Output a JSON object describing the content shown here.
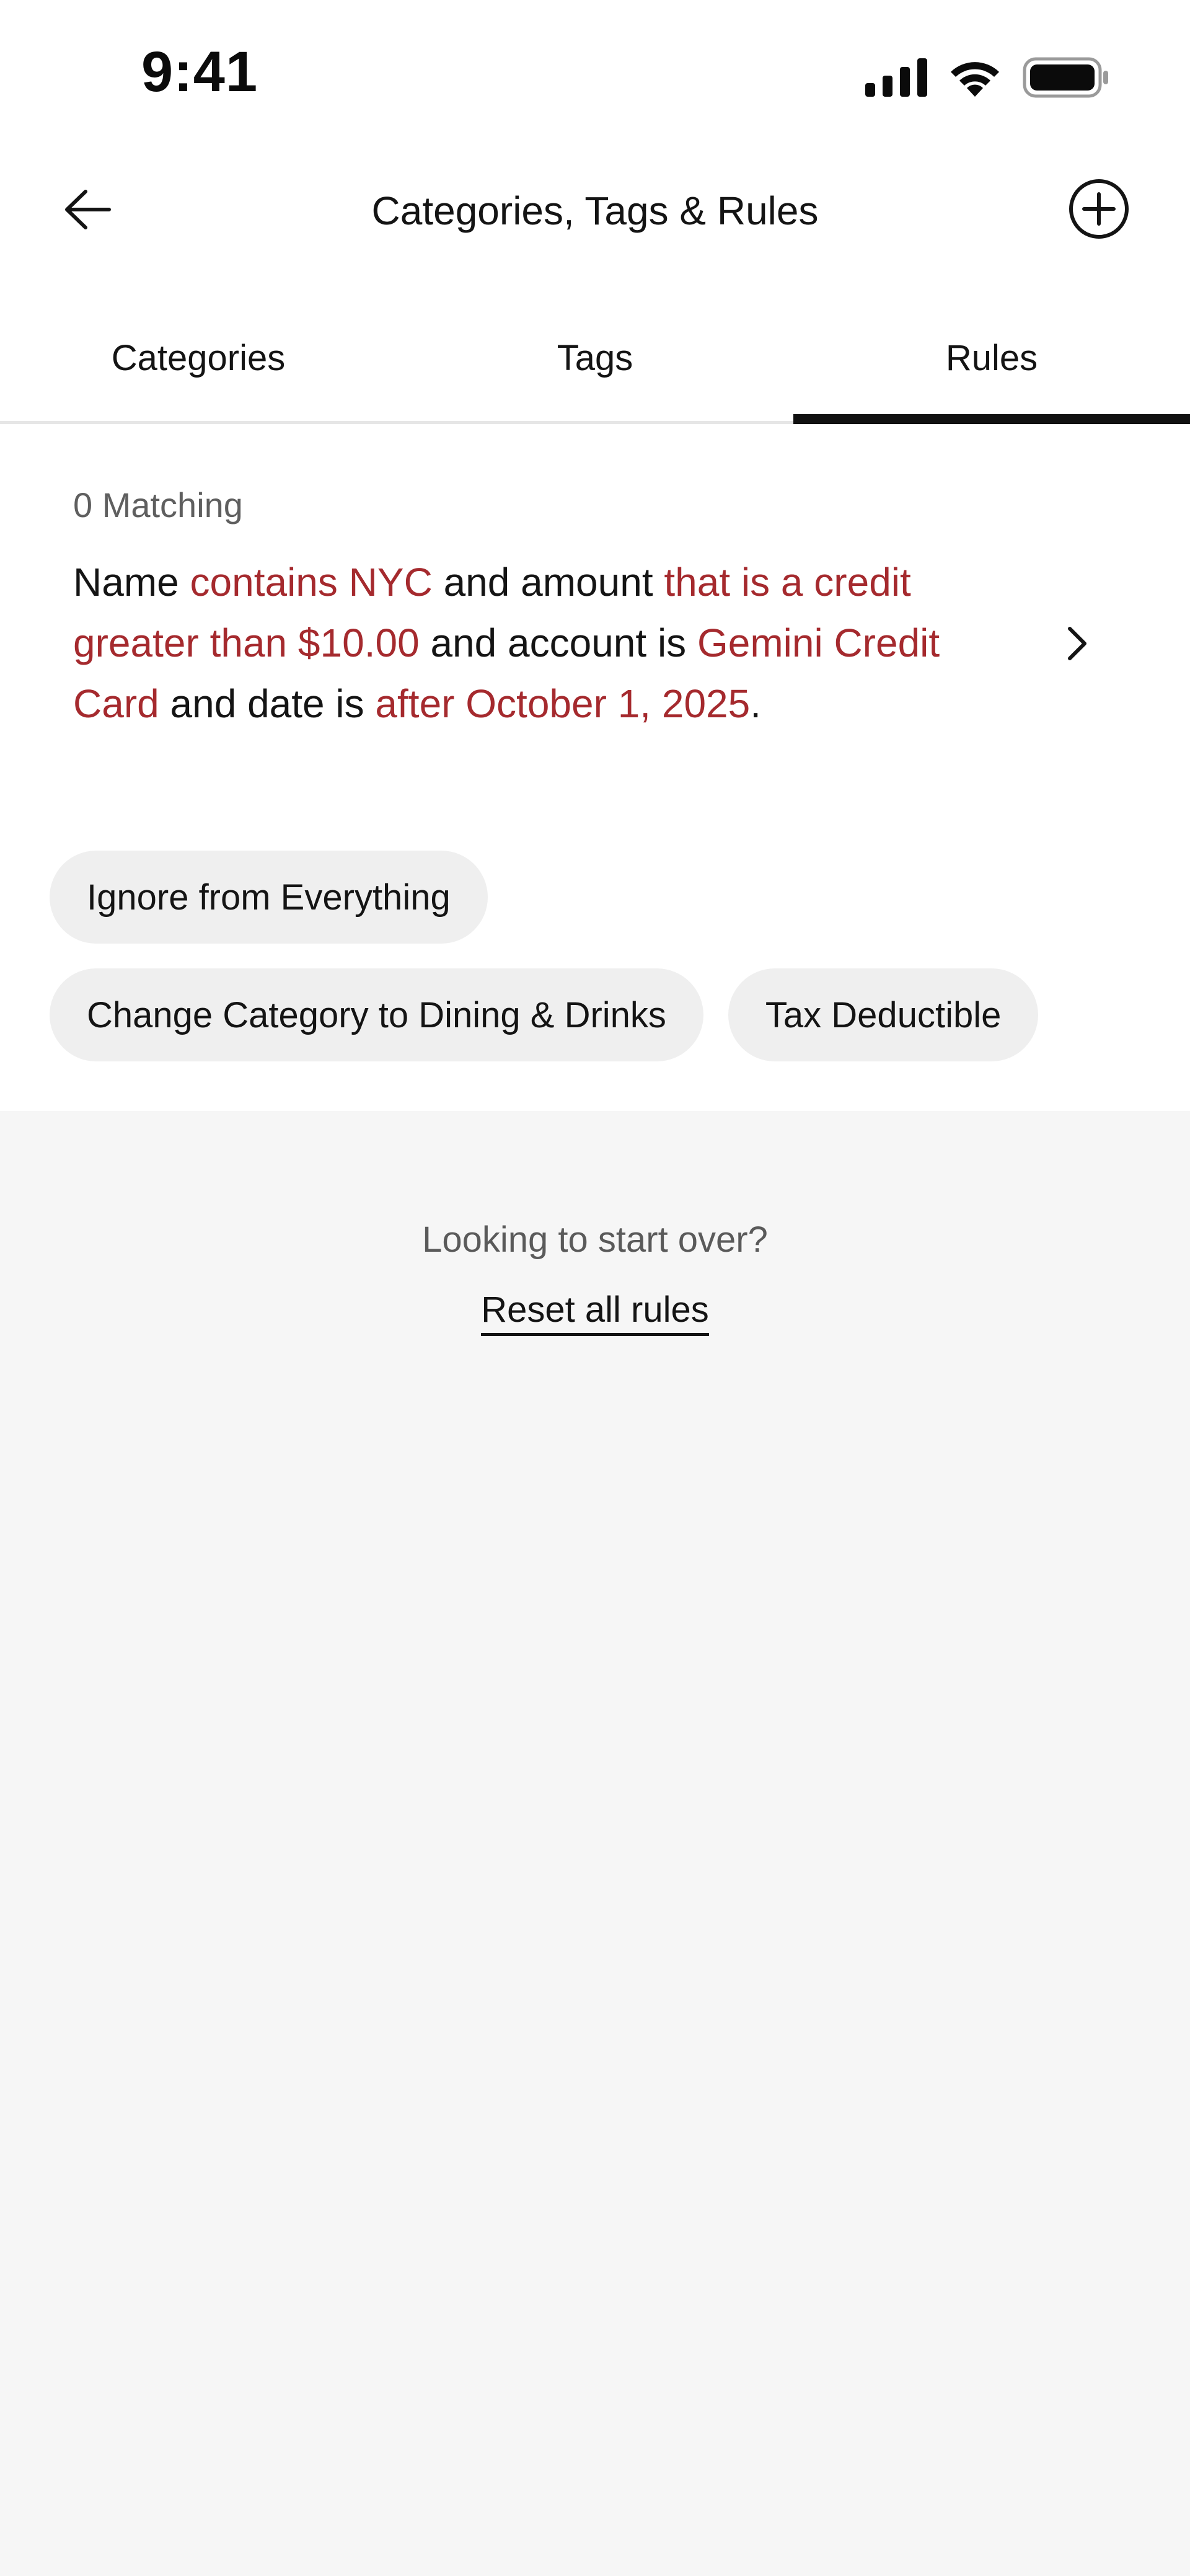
{
  "status_bar": {
    "time": "9:41",
    "icons": [
      "signal-icon",
      "wifi-icon",
      "battery-icon"
    ]
  },
  "header": {
    "title": "Categories, Tags & Rules",
    "back_icon": "arrow-left-icon",
    "add_icon": "plus-circle-icon"
  },
  "tabs": [
    {
      "label": "Categories",
      "active": false
    },
    {
      "label": "Tags",
      "active": false
    },
    {
      "label": "Rules",
      "active": true
    }
  ],
  "rule": {
    "matching": "0 Matching",
    "t1": "Name ",
    "h1": "contains NYC",
    "t2": " and amount ",
    "h2": "that is a credit greater than $10.00",
    "t3": " and account is ",
    "h3": "Gemini Credit Card",
    "t4": " and date is ",
    "h4": "after October 1, 2025",
    "t5": ".",
    "chevron_icon": "chevron-right-icon"
  },
  "actions": [
    "Ignore from Everything",
    "Change Category to Dining & Drinks",
    "Tax Deductible"
  ],
  "footer": {
    "prompt": "Looking to start over?",
    "reset_label": "Reset all rules"
  },
  "colors": {
    "highlight": "#a52a2e",
    "chip_bg": "#efefef",
    "page_bg": "#f6f6f6"
  }
}
